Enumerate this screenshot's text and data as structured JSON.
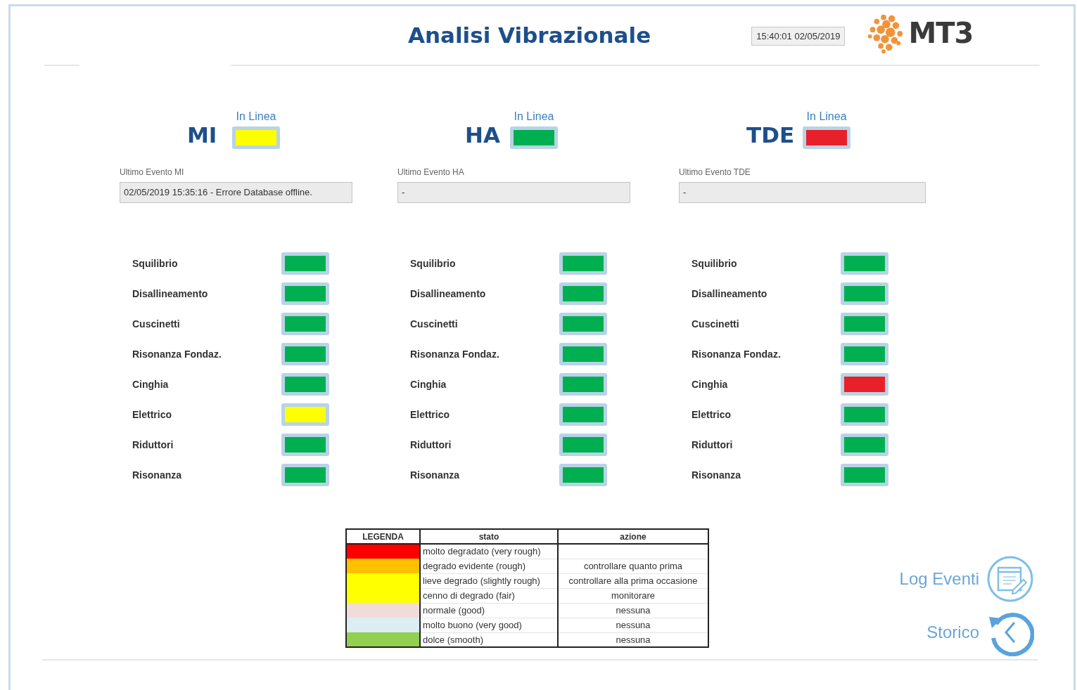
{
  "header": {
    "title": "Analisi Vibrazionale",
    "timestamp": "15:40:01 02/05/2019",
    "logo_text": "MT3"
  },
  "machines": [
    {
      "name": "MI",
      "status": {
        "label": "In Linea",
        "color": "#ffff00"
      },
      "event_label": "Ultimo Evento MI",
      "event_value": "02/05/2019 15:35:16 - Errore Database offline.",
      "checks": [
        {
          "label": "Squilibrio",
          "color": "#00b050"
        },
        {
          "label": "Disallineamento",
          "color": "#00b050"
        },
        {
          "label": "Cuscinetti",
          "color": "#00b050"
        },
        {
          "label": "Risonanza Fondaz.",
          "color": "#00b050"
        },
        {
          "label": "Cinghia",
          "color": "#00b050"
        },
        {
          "label": "Elettrico",
          "color": "#ffff00"
        },
        {
          "label": "Riduttori",
          "color": "#00b050"
        },
        {
          "label": "Risonanza",
          "color": "#00b050"
        }
      ]
    },
    {
      "name": "HA",
      "status": {
        "label": "In Linea",
        "color": "#00b050"
      },
      "event_label": "Ultimo Evento HA",
      "event_value": "-",
      "checks": [
        {
          "label": "Squilibrio",
          "color": "#00b050"
        },
        {
          "label": "Disallineamento",
          "color": "#00b050"
        },
        {
          "label": "Cuscinetti",
          "color": "#00b050"
        },
        {
          "label": "Risonanza Fondaz.",
          "color": "#00b050"
        },
        {
          "label": "Cinghia",
          "color": "#00b050"
        },
        {
          "label": "Elettrico",
          "color": "#00b050"
        },
        {
          "label": "Riduttori",
          "color": "#00b050"
        },
        {
          "label": "Risonanza",
          "color": "#00b050"
        }
      ]
    },
    {
      "name": "TDE",
      "status": {
        "label": "In Linea",
        "color": "#e8202a"
      },
      "event_label": "Ultimo Evento TDE",
      "event_value": "-",
      "checks": [
        {
          "label": "Squilibrio",
          "color": "#00b050"
        },
        {
          "label": "Disallineamento",
          "color": "#00b050"
        },
        {
          "label": "Cuscinetti",
          "color": "#00b050"
        },
        {
          "label": "Risonanza Fondaz.",
          "color": "#00b050"
        },
        {
          "label": "Cinghia",
          "color": "#e8202a"
        },
        {
          "label": "Elettrico",
          "color": "#00b050"
        },
        {
          "label": "Riduttori",
          "color": "#00b050"
        },
        {
          "label": "Risonanza",
          "color": "#00b050"
        }
      ]
    }
  ],
  "legend": {
    "columns": [
      "LEGENDA",
      "stato",
      "azione"
    ],
    "rows": [
      {
        "color": "#ff0000",
        "stato": "molto degradato (very rough)"
      },
      {
        "color": "#ffc000",
        "stato": "degrado evidente (rough)",
        "azione": "controllare quanto prima"
      },
      {
        "color": "#ffff00",
        "stato": "lieve degrado (slightly rough)",
        "azione": "controllare alla prima occasione"
      },
      {
        "color": "#ffff00",
        "stato": "cenno di degrado (fair)",
        "azione": "monitorare"
      },
      {
        "color": "#f2dcdb",
        "stato": "normale (good)",
        "azione": "nessuna"
      },
      {
        "color": "#daeef3",
        "stato": "molto buono (very good)",
        "azione": "nessuna"
      },
      {
        "color": "#92d050",
        "stato": "dolce (smooth)",
        "azione": "nessuna"
      }
    ]
  },
  "actions": [
    {
      "kind": "log",
      "label": "Log Eventi"
    },
    {
      "kind": "history",
      "label": "Storico"
    }
  ]
}
